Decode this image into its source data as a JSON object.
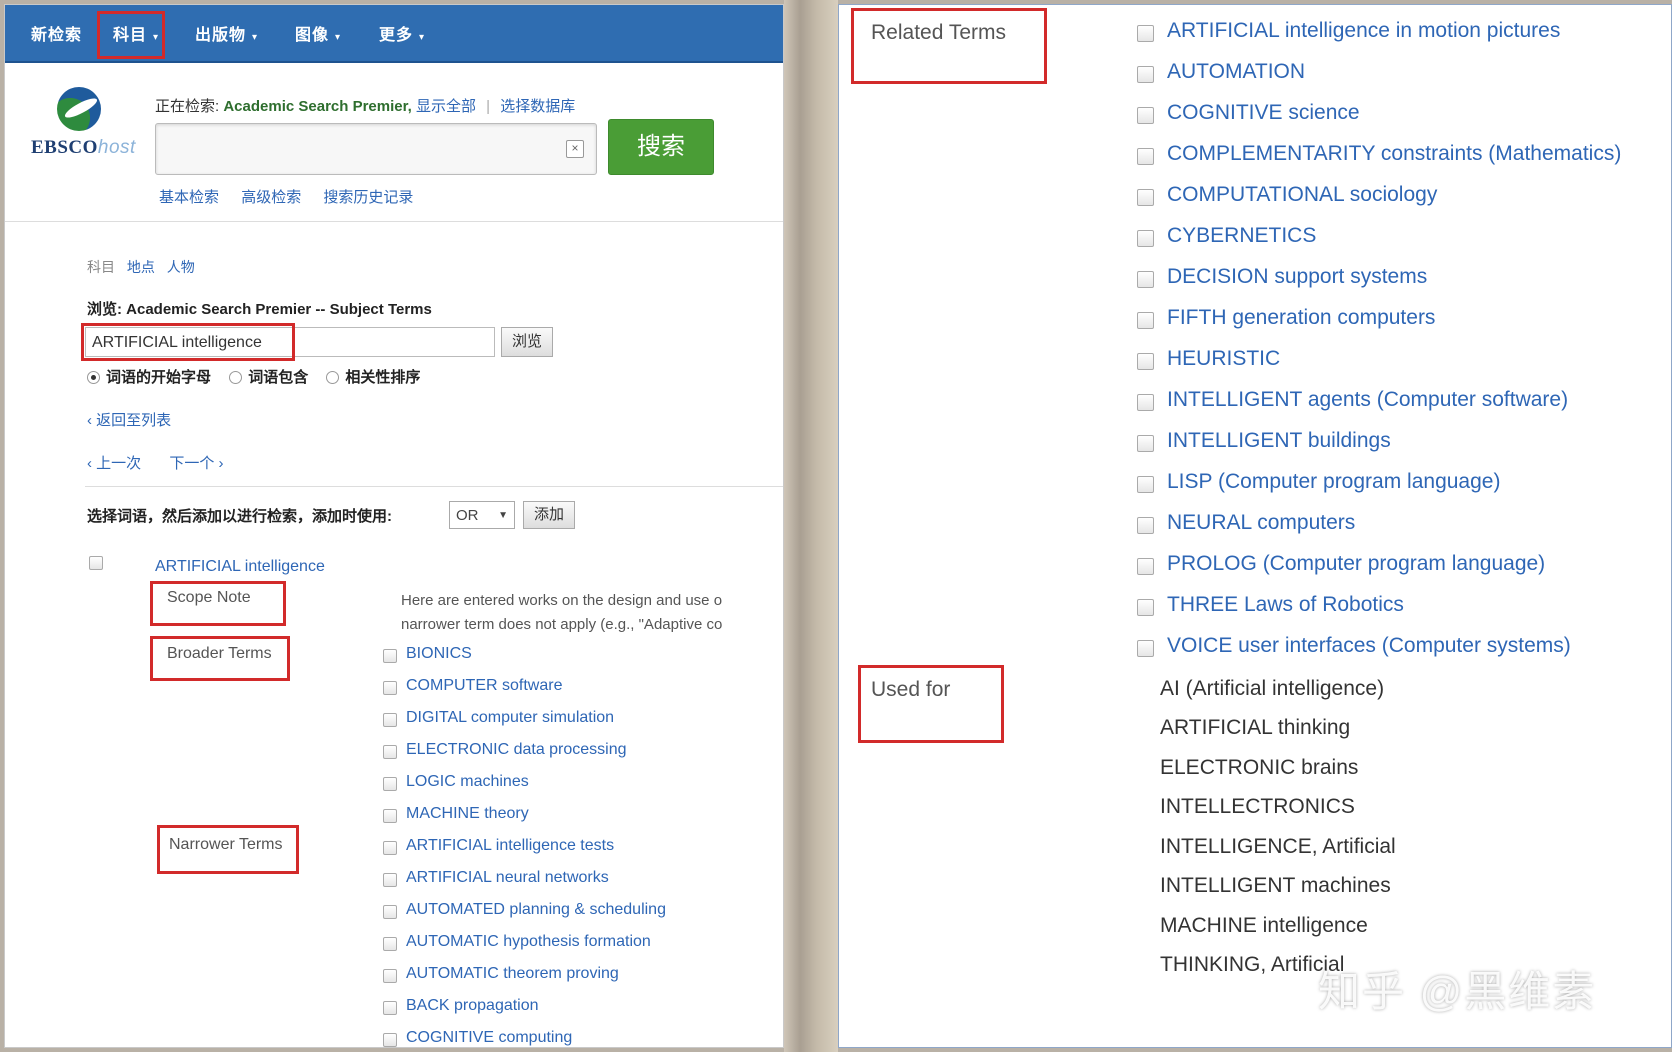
{
  "nav": {
    "items": [
      {
        "label": "新检索",
        "caret": ""
      },
      {
        "label": "科目",
        "caret": "▾"
      },
      {
        "label": "出版物",
        "caret": "▾"
      },
      {
        "label": "图像",
        "caret": "▾"
      },
      {
        "label": "更多",
        "caret": "▾"
      }
    ]
  },
  "logo": {
    "brand": "EBSCO",
    "suffix": "host"
  },
  "search": {
    "searching_prefix": "正在检索:",
    "database": "Academic Search Premier,",
    "show_all": "显示全部",
    "choose_db": "选择数据库",
    "input_value": "",
    "clear_glyph": "×",
    "button_label": "搜索",
    "links": [
      "基本检索",
      "高级检索",
      "搜索历史记录"
    ]
  },
  "browse": {
    "tabs": {
      "current": "科目",
      "links": [
        "地点",
        "人物"
      ]
    },
    "title": "浏览: Academic Search Premier -- Subject Terms",
    "input_value": "ARTIFICIAL intelligence",
    "browse_button": "浏览",
    "radio_options": [
      {
        "label": "词语的开始字母",
        "selected": true
      },
      {
        "label": "词语包含",
        "selected": false
      },
      {
        "label": "相关性排序",
        "selected": false
      }
    ],
    "back_to_list": "‹ 返回至列表",
    "prev": "‹ 上一次",
    "next": "下一个 ›",
    "add_instruction": "选择词语，然后添加以进行检索，添加时使用:",
    "operator": "OR",
    "add_button": "添加"
  },
  "term": {
    "main": "ARTIFICIAL intelligence",
    "scope_note_label": "Scope Note",
    "scope_note_line1": "Here are entered works on the design and use o",
    "scope_note_line2": "narrower term does not apply (e.g., \"Adaptive co",
    "broader_label": "Broader Terms",
    "narrower_label": "Narrower Terms",
    "broader_terms": [
      "BIONICS",
      "COMPUTER software",
      "DIGITAL computer simulation",
      "ELECTRONIC data processing",
      "LOGIC machines",
      "MACHINE theory"
    ],
    "narrower_terms": [
      "ARTIFICIAL intelligence tests",
      "ARTIFICIAL neural networks",
      "AUTOMATED planning & scheduling",
      "AUTOMATIC hypothesis formation",
      "AUTOMATIC theorem proving",
      "BACK propagation",
      "COGNITIVE computing"
    ]
  },
  "related": {
    "label": "Related Terms",
    "items": [
      "ARTIFICIAL intelligence in motion pictures",
      "AUTOMATION",
      "COGNITIVE science",
      "COMPLEMENTARITY constraints (Mathematics)",
      "COMPUTATIONAL sociology",
      "CYBERNETICS",
      "DECISION support systems",
      "FIFTH generation computers",
      "HEURISTIC",
      "INTELLIGENT agents (Computer software)",
      "INTELLIGENT buildings",
      "LISP (Computer program language)",
      "NEURAL computers",
      "PROLOG (Computer program language)",
      "THREE Laws of Robotics",
      "VOICE user interfaces (Computer systems)"
    ]
  },
  "used_for": {
    "label": "Used for",
    "items": [
      "AI (Artificial intelligence)",
      "ARTIFICIAL thinking",
      "ELECTRONIC brains",
      "INTELLECTRONICS",
      "INTELLIGENCE, Artificial",
      "INTELLIGENT machines",
      "MACHINE intelligence",
      "THINKING, Artificial"
    ]
  },
  "watermark": "知乎 @黑维素",
  "colors": {
    "nav_bg": "#2f6db1",
    "link": "#2e66b5",
    "search_button": "#4a9d36",
    "highlight_box": "#d22a2a"
  }
}
